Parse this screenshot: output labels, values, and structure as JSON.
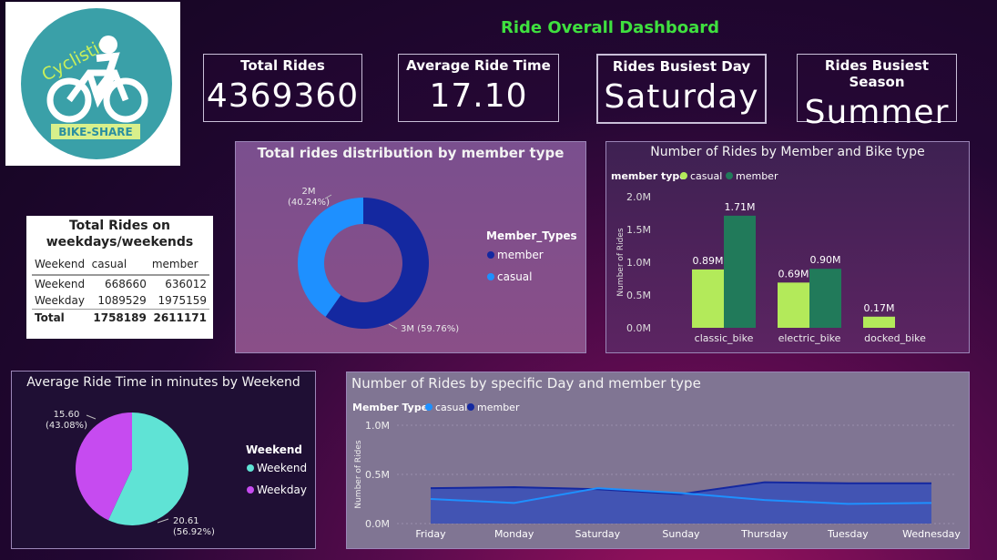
{
  "logo": {
    "top_text": "Cyclistic",
    "bottom_text": "BIKE-SHARE"
  },
  "title": "Ride Overall Dashboard",
  "kpis": [
    {
      "label": "Total Rides",
      "value": "4369360"
    },
    {
      "label": "Average Ride Time",
      "value": "17.10"
    },
    {
      "label": "Rides Busiest Day",
      "value": "Saturday"
    },
    {
      "label": "Rides Busiest Season",
      "value": "Summer"
    }
  ],
  "table": {
    "title_line1": "Total Rides on",
    "title_line2": "weekdays/weekends",
    "headers": [
      "Weekend",
      "casual",
      "member"
    ],
    "rows": [
      [
        "Weekend",
        "668660",
        "636012"
      ],
      [
        "Weekday",
        "1089529",
        "1975159"
      ]
    ],
    "total": [
      "Total",
      "1758189",
      "2611171"
    ]
  },
  "colors": {
    "member_dark": "#1428a0",
    "casual_blue": "#1e90ff",
    "casual_green": "#b3ea5a",
    "member_green": "#217a5a",
    "teal": "#5fe3d5",
    "magenta": "#c64bf0"
  },
  "chart_data": [
    {
      "type": "pie",
      "title": "Total rides distribution by member type",
      "legend_title": "Member_Types",
      "categories": [
        "member",
        "casual"
      ],
      "values": [
        59.76,
        40.24
      ],
      "slice_labels": [
        "3M (59.76%)",
        "2M\n(40.24%)"
      ],
      "legend": [
        "member",
        "casual"
      ],
      "legend_placement": "right",
      "donut": true
    },
    {
      "type": "bar",
      "title": "Number of Rides by Member and Bike type",
      "legend_title": "member type",
      "categories": [
        "classic_bike",
        "electric_bike",
        "docked_bike"
      ],
      "series": [
        {
          "name": "casual",
          "values": [
            0.89,
            0.69,
            0.17
          ],
          "labels": [
            "0.89M",
            "0.69M",
            "0.17M"
          ]
        },
        {
          "name": "member",
          "values": [
            1.71,
            0.9,
            null
          ],
          "labels": [
            "1.71M",
            "0.90M",
            ""
          ]
        }
      ],
      "ylabel": "Number of Rides",
      "ylim": [
        0,
        2.0
      ],
      "yticks": [
        "0.0M",
        "0.5M",
        "1.0M",
        "1.5M",
        "2.0M"
      ],
      "legend_placement": "top-left"
    },
    {
      "type": "pie",
      "title": "Average Ride Time in minutes by Weekend",
      "legend_title": "Weekend",
      "categories": [
        "Weekend",
        "Weekday"
      ],
      "values": [
        20.61,
        15.6
      ],
      "slice_labels": [
        "20.61\n(56.92%)",
        "15.60\n(43.08%)"
      ],
      "legend": [
        "Weekend",
        "Weekday"
      ],
      "legend_placement": "right"
    },
    {
      "type": "area",
      "title": "Number of Rides by specific Day and member type",
      "legend_title": "Member Type",
      "categories": [
        "Friday",
        "Monday",
        "Saturday",
        "Sunday",
        "Thursday",
        "Tuesday",
        "Wednesday"
      ],
      "series": [
        {
          "name": "casual",
          "values": [
            0.25,
            0.21,
            0.36,
            0.31,
            0.24,
            0.2,
            0.21
          ]
        },
        {
          "name": "member",
          "values": [
            0.36,
            0.37,
            0.35,
            0.3,
            0.42,
            0.41,
            0.41
          ]
        }
      ],
      "ylabel": "Number of Rides",
      "ylim": [
        0,
        1.0
      ],
      "yticks": [
        "0.0M",
        "0.5M",
        "1.0M"
      ],
      "legend_placement": "top-left",
      "grid": true
    }
  ]
}
